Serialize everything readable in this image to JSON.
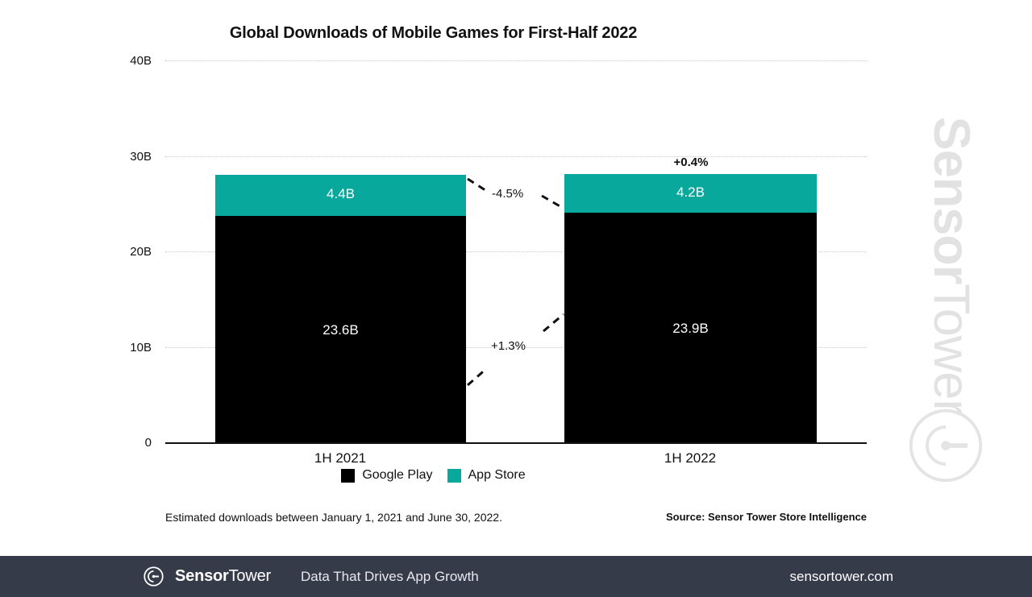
{
  "chart_data": {
    "type": "bar",
    "subtype": "stacked-bar",
    "title": "Global Downloads of Mobile Games for First-Half 2022",
    "categories": [
      "1H 2021",
      "1H 2022"
    ],
    "series": [
      {
        "name": "Google Play",
        "color": "#000000",
        "values": [
          23.6,
          23.9
        ],
        "labels": [
          "23.6B",
          "23.9B"
        ]
      },
      {
        "name": "App Store",
        "color": "#08a99c",
        "values": [
          4.4,
          4.2
        ],
        "labels": [
          "4.4B",
          "4.2B"
        ]
      }
    ],
    "totals": [
      28.0,
      28.1
    ],
    "xlabel": "",
    "ylabel": "",
    "ylim": [
      0,
      40
    ],
    "yticks": [
      0,
      10,
      20,
      30,
      40
    ],
    "ytick_labels": [
      "0",
      "10B",
      "20B",
      "30B",
      "40B"
    ],
    "grid": true,
    "legend_position": "bottom",
    "annotations": [
      {
        "id": "total-growth",
        "text": "+0.4%",
        "target": "1H 2022 total",
        "bold": true
      },
      {
        "id": "appstore-change",
        "text": "-4.5%",
        "target": "App Store 1H2021 to 1H2022",
        "direction": "down"
      },
      {
        "id": "googleplay-change",
        "text": "+1.3%",
        "target": "Google Play 1H2021 to 1H2022",
        "direction": "up"
      }
    ],
    "footnote": "Estimated downloads between January 1, 2021 and June 30, 2022.",
    "source": "Source: Sensor Tower Store Intelligence"
  },
  "header": {
    "title": "Global Downloads of Mobile Games for First-Half 2022"
  },
  "axis": {
    "y_labels": [
      "40B",
      "30B",
      "20B",
      "10B",
      "0"
    ],
    "x_labels": [
      "1H 2021",
      "1H 2022"
    ]
  },
  "bars": {
    "bar1": {
      "category": "1H 2021",
      "app_store_label": "4.4B",
      "google_play_label": "23.6B"
    },
    "bar2": {
      "category": "1H 2022",
      "app_store_label": "4.2B",
      "google_play_label": "23.9B",
      "growth_label": "+0.4%"
    }
  },
  "connectors": {
    "app_store_change": "-4.5%",
    "google_play_change": "+1.3%"
  },
  "legend": {
    "items": [
      {
        "label": "Google Play",
        "color": "#000000",
        "swatch": "google-play-swatch"
      },
      {
        "label": "App Store",
        "color": "#08a99c",
        "swatch": "app-store-swatch"
      }
    ]
  },
  "notes": {
    "footnote": "Estimated downloads between January 1, 2021 and June 30, 2022.",
    "source": "Source: Sensor Tower Store Intelligence"
  },
  "watermark": {
    "brand_bold": "Sensor",
    "brand_light": "Tower",
    "icon": "sensor-tower-logo-icon"
  },
  "footer": {
    "brand_bold": "Sensor",
    "brand_light": "Tower",
    "tagline": "Data That Drives App Growth",
    "url": "sensortower.com",
    "background": "#363b4a"
  }
}
